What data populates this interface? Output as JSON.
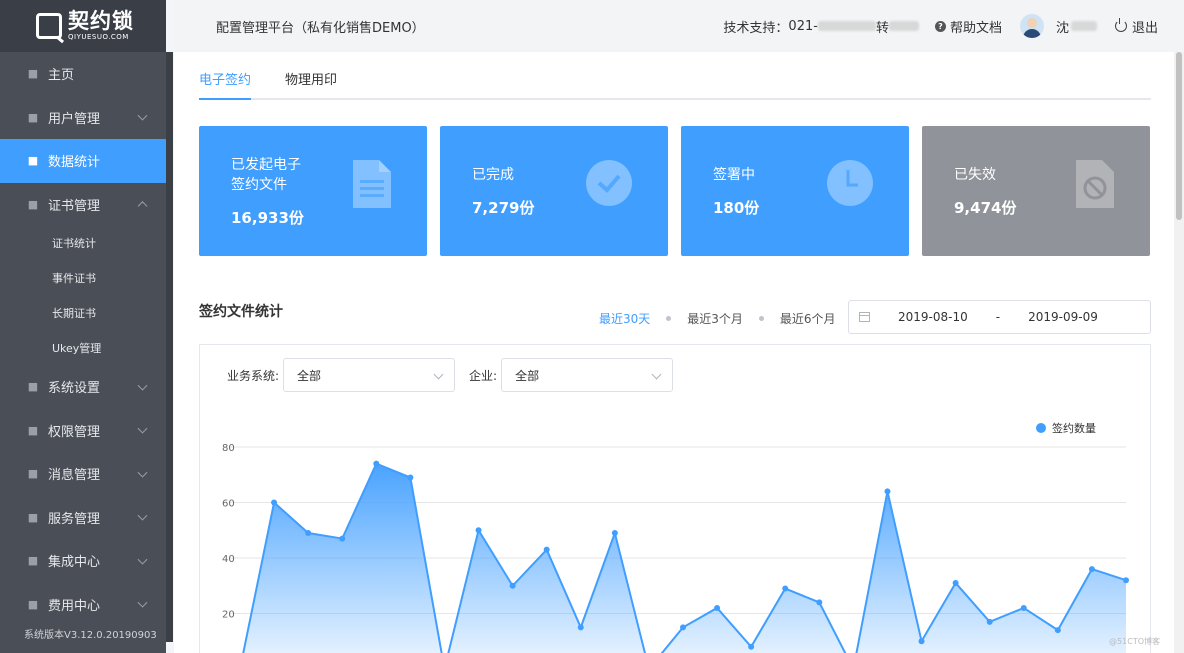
{
  "logo": {
    "name": "契约锁",
    "sub": "QIYUESUO.COM"
  },
  "sidebar": {
    "items": [
      {
        "label": "主页",
        "icon": "home-icon",
        "arrow": false
      },
      {
        "label": "用户管理",
        "icon": "user-icon",
        "arrow": true
      },
      {
        "label": "数据统计",
        "icon": "chart-icon",
        "arrow": false,
        "active": true
      },
      {
        "label": "证书管理",
        "icon": "certificate-icon",
        "arrow": true,
        "expanded": true
      }
    ],
    "sub_items": [
      "证书统计",
      "事件证书",
      "长期证书",
      "Ukey管理"
    ],
    "items_after": [
      {
        "label": "系统设置",
        "icon": "gear-icon",
        "arrow": true
      },
      {
        "label": "权限管理",
        "icon": "lock-icon",
        "arrow": true
      },
      {
        "label": "消息管理",
        "icon": "message-icon",
        "arrow": true
      },
      {
        "label": "服务管理",
        "icon": "service-icon",
        "arrow": true
      },
      {
        "label": "集成中心",
        "icon": "integration-icon",
        "arrow": true
      },
      {
        "label": "费用中心",
        "icon": "billing-icon",
        "arrow": true
      }
    ],
    "version": "系统版本V3.12.0.20190903"
  },
  "header": {
    "title": "配置管理平台（私有化销售DEMO）",
    "support_label": "技术支持：",
    "support_prefix": "021-",
    "support_ext_label": "转",
    "help": "帮助文档",
    "user": "沈",
    "logout": "退出"
  },
  "tabs": [
    {
      "label": "电子签约",
      "active": true
    },
    {
      "label": "物理用印",
      "active": false
    }
  ],
  "cards": [
    {
      "label": "已发起电子\n签约文件",
      "value": "16,933份",
      "icon": "document-icon",
      "color": "#409eff"
    },
    {
      "label": "已完成",
      "value": "7,279份",
      "icon": "check-circle-icon",
      "color": "#409eff"
    },
    {
      "label": "签署中",
      "value": "180份",
      "icon": "clock-icon",
      "color": "#409eff"
    },
    {
      "label": "已失效",
      "value": "9,474份",
      "icon": "invalid-document-icon",
      "color": "#909399"
    }
  ],
  "stats": {
    "title": "签约文件统计",
    "ranges": [
      "最近30天",
      "最近3个月",
      "最近6个月"
    ],
    "active_range": 0,
    "date_from": "2019-08-10",
    "date_sep": "-",
    "date_to": "2019-09-09"
  },
  "filters": {
    "system_label": "业务系统:",
    "system_value": "全部",
    "company_label": "企业:",
    "company_value": "全部"
  },
  "watermark": "@51CTO博客",
  "chart_data": {
    "type": "area",
    "series": [
      {
        "name": "签约数量",
        "values": [
          0,
          60,
          49,
          47,
          74,
          69,
          0,
          50,
          30,
          43,
          15,
          49,
          0,
          15,
          22,
          8,
          29,
          24,
          0,
          64,
          10,
          31,
          17,
          22,
          14,
          36,
          32
        ]
      }
    ],
    "yticks": [
      20,
      40,
      60,
      80
    ],
    "ylim": [
      0,
      80
    ],
    "color": "#409eff",
    "legend_position": "top-right"
  }
}
